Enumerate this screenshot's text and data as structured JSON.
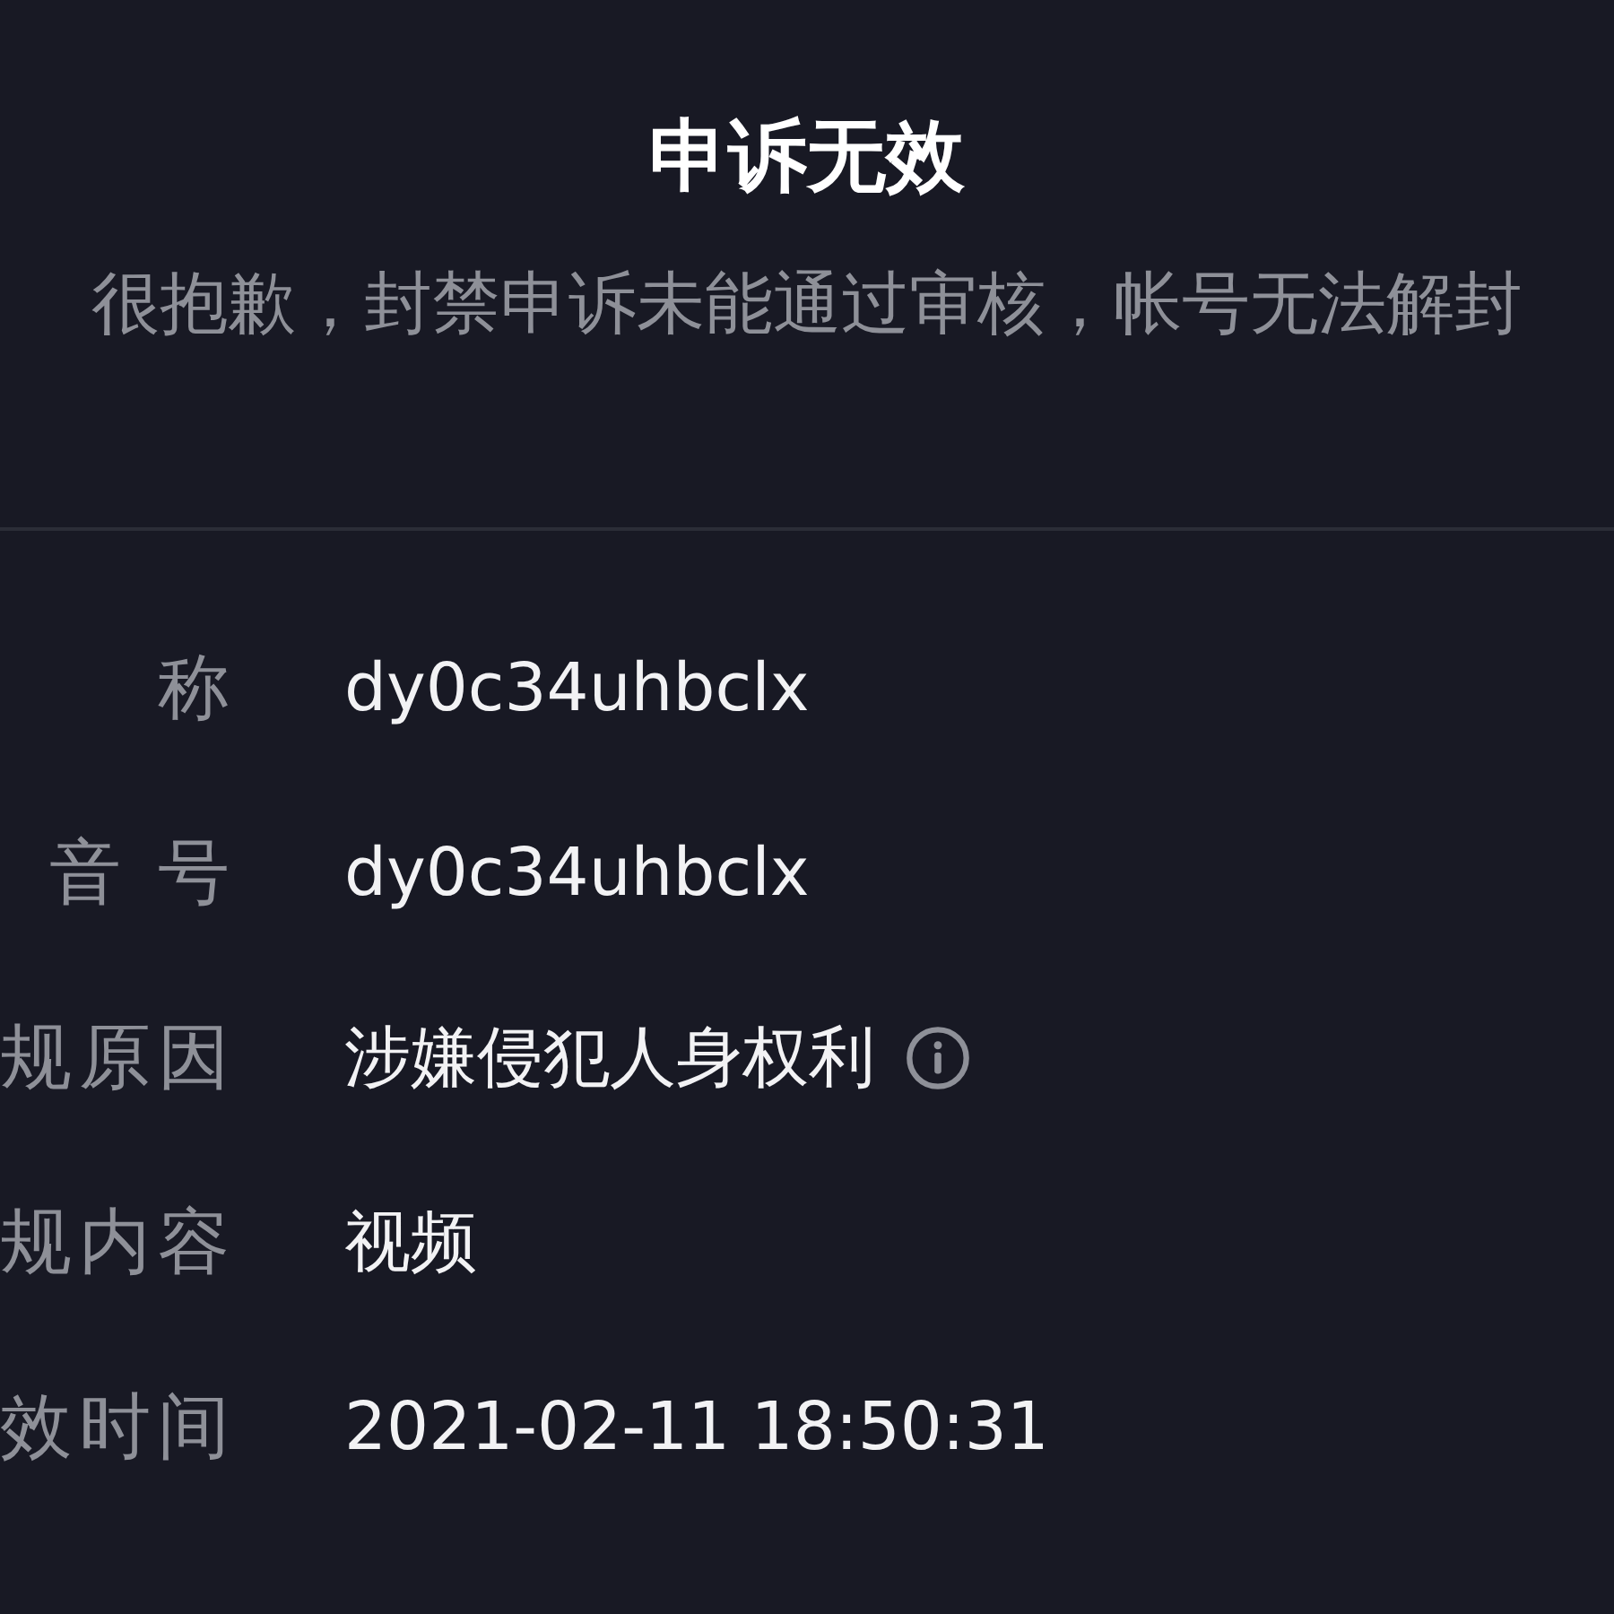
{
  "title": "申诉无效",
  "subtitle": "很抱歉，封禁申诉未能通过审核，帐号无法解封",
  "details": [
    {
      "label": "称",
      "value": "dy0c34uhbclx",
      "info": false
    },
    {
      "label": "音 号",
      "value": "dy0c34uhbclx",
      "info": false
    },
    {
      "label": "规原因",
      "value": "涉嫌侵犯人身权利",
      "info": true
    },
    {
      "label": "规内容",
      "value": "视频",
      "info": false
    },
    {
      "label": "效时间",
      "value": "2021-02-11 18:50:31",
      "info": false
    }
  ]
}
